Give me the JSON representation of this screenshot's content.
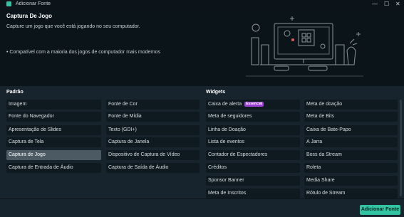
{
  "window": {
    "title": "Adicionar Fonte",
    "minimize": "—",
    "maximize": "☐",
    "close": "✕"
  },
  "header": {
    "title": "Captura De Jogo",
    "description": "Capture um jogo que você está jogando no seu computador.",
    "bullet": "•  Compatível com a maioria dos jogos de computador mais modernos"
  },
  "standard": {
    "title": "Padrão",
    "col1": [
      "Imagem",
      "Fonte do Navegador",
      "Apresentação de Slides",
      "Captura de Tela",
      "Captura de Jogo",
      "Captura de Entrada de Áudio"
    ],
    "col2": [
      "Fonte de Cor",
      "Fonte de Mídia",
      "Texto (GDI+)",
      "Captura de Janela",
      "Dispositivo de Captura de Vídeo",
      "Captura de Saída de Áudio"
    ],
    "selected": "Captura de Jogo"
  },
  "widgets": {
    "title": "Widgets",
    "col1": [
      "Caixa de alerta",
      "Meta de seguidores",
      "Linha de Doação",
      "Lista de eventos",
      "Contador de Espectadores",
      "Créditos",
      "Sponsor Banner",
      "Meta de Inscritos"
    ],
    "col2": [
      "Meta de doação",
      "Meta de Bits",
      "Caixa de Bate-Papo",
      "A Jarra",
      "Boss da Stream",
      "Roleta",
      "Media Share",
      "Rótulo de Stream"
    ],
    "badge": "Essencial"
  },
  "footer": {
    "add_button": "Adicionar Fonte"
  },
  "colors": {
    "accent": "#31c3a2",
    "badge": "#9b3fd6",
    "background": "#17242d",
    "header_bg": "#0a1419"
  }
}
